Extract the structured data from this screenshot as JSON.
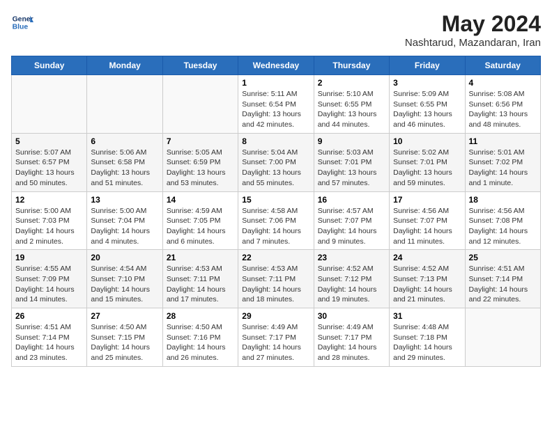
{
  "header": {
    "logo_line1": "General",
    "logo_line2": "Blue",
    "month_title": "May 2024",
    "location": "Nashtarud, Mazandaran, Iran"
  },
  "days_of_week": [
    "Sunday",
    "Monday",
    "Tuesday",
    "Wednesday",
    "Thursday",
    "Friday",
    "Saturday"
  ],
  "weeks": [
    [
      {
        "day": "",
        "info": ""
      },
      {
        "day": "",
        "info": ""
      },
      {
        "day": "",
        "info": ""
      },
      {
        "day": "1",
        "info": "Sunrise: 5:11 AM\nSunset: 6:54 PM\nDaylight: 13 hours and 42 minutes."
      },
      {
        "day": "2",
        "info": "Sunrise: 5:10 AM\nSunset: 6:55 PM\nDaylight: 13 hours and 44 minutes."
      },
      {
        "day": "3",
        "info": "Sunrise: 5:09 AM\nSunset: 6:55 PM\nDaylight: 13 hours and 46 minutes."
      },
      {
        "day": "4",
        "info": "Sunrise: 5:08 AM\nSunset: 6:56 PM\nDaylight: 13 hours and 48 minutes."
      }
    ],
    [
      {
        "day": "5",
        "info": "Sunrise: 5:07 AM\nSunset: 6:57 PM\nDaylight: 13 hours and 50 minutes."
      },
      {
        "day": "6",
        "info": "Sunrise: 5:06 AM\nSunset: 6:58 PM\nDaylight: 13 hours and 51 minutes."
      },
      {
        "day": "7",
        "info": "Sunrise: 5:05 AM\nSunset: 6:59 PM\nDaylight: 13 hours and 53 minutes."
      },
      {
        "day": "8",
        "info": "Sunrise: 5:04 AM\nSunset: 7:00 PM\nDaylight: 13 hours and 55 minutes."
      },
      {
        "day": "9",
        "info": "Sunrise: 5:03 AM\nSunset: 7:01 PM\nDaylight: 13 hours and 57 minutes."
      },
      {
        "day": "10",
        "info": "Sunrise: 5:02 AM\nSunset: 7:01 PM\nDaylight: 13 hours and 59 minutes."
      },
      {
        "day": "11",
        "info": "Sunrise: 5:01 AM\nSunset: 7:02 PM\nDaylight: 14 hours and 1 minute."
      }
    ],
    [
      {
        "day": "12",
        "info": "Sunrise: 5:00 AM\nSunset: 7:03 PM\nDaylight: 14 hours and 2 minutes."
      },
      {
        "day": "13",
        "info": "Sunrise: 5:00 AM\nSunset: 7:04 PM\nDaylight: 14 hours and 4 minutes."
      },
      {
        "day": "14",
        "info": "Sunrise: 4:59 AM\nSunset: 7:05 PM\nDaylight: 14 hours and 6 minutes."
      },
      {
        "day": "15",
        "info": "Sunrise: 4:58 AM\nSunset: 7:06 PM\nDaylight: 14 hours and 7 minutes."
      },
      {
        "day": "16",
        "info": "Sunrise: 4:57 AM\nSunset: 7:07 PM\nDaylight: 14 hours and 9 minutes."
      },
      {
        "day": "17",
        "info": "Sunrise: 4:56 AM\nSunset: 7:07 PM\nDaylight: 14 hours and 11 minutes."
      },
      {
        "day": "18",
        "info": "Sunrise: 4:56 AM\nSunset: 7:08 PM\nDaylight: 14 hours and 12 minutes."
      }
    ],
    [
      {
        "day": "19",
        "info": "Sunrise: 4:55 AM\nSunset: 7:09 PM\nDaylight: 14 hours and 14 minutes."
      },
      {
        "day": "20",
        "info": "Sunrise: 4:54 AM\nSunset: 7:10 PM\nDaylight: 14 hours and 15 minutes."
      },
      {
        "day": "21",
        "info": "Sunrise: 4:53 AM\nSunset: 7:11 PM\nDaylight: 14 hours and 17 minutes."
      },
      {
        "day": "22",
        "info": "Sunrise: 4:53 AM\nSunset: 7:11 PM\nDaylight: 14 hours and 18 minutes."
      },
      {
        "day": "23",
        "info": "Sunrise: 4:52 AM\nSunset: 7:12 PM\nDaylight: 14 hours and 19 minutes."
      },
      {
        "day": "24",
        "info": "Sunrise: 4:52 AM\nSunset: 7:13 PM\nDaylight: 14 hours and 21 minutes."
      },
      {
        "day": "25",
        "info": "Sunrise: 4:51 AM\nSunset: 7:14 PM\nDaylight: 14 hours and 22 minutes."
      }
    ],
    [
      {
        "day": "26",
        "info": "Sunrise: 4:51 AM\nSunset: 7:14 PM\nDaylight: 14 hours and 23 minutes."
      },
      {
        "day": "27",
        "info": "Sunrise: 4:50 AM\nSunset: 7:15 PM\nDaylight: 14 hours and 25 minutes."
      },
      {
        "day": "28",
        "info": "Sunrise: 4:50 AM\nSunset: 7:16 PM\nDaylight: 14 hours and 26 minutes."
      },
      {
        "day": "29",
        "info": "Sunrise: 4:49 AM\nSunset: 7:17 PM\nDaylight: 14 hours and 27 minutes."
      },
      {
        "day": "30",
        "info": "Sunrise: 4:49 AM\nSunset: 7:17 PM\nDaylight: 14 hours and 28 minutes."
      },
      {
        "day": "31",
        "info": "Sunrise: 4:48 AM\nSunset: 7:18 PM\nDaylight: 14 hours and 29 minutes."
      },
      {
        "day": "",
        "info": ""
      }
    ]
  ]
}
